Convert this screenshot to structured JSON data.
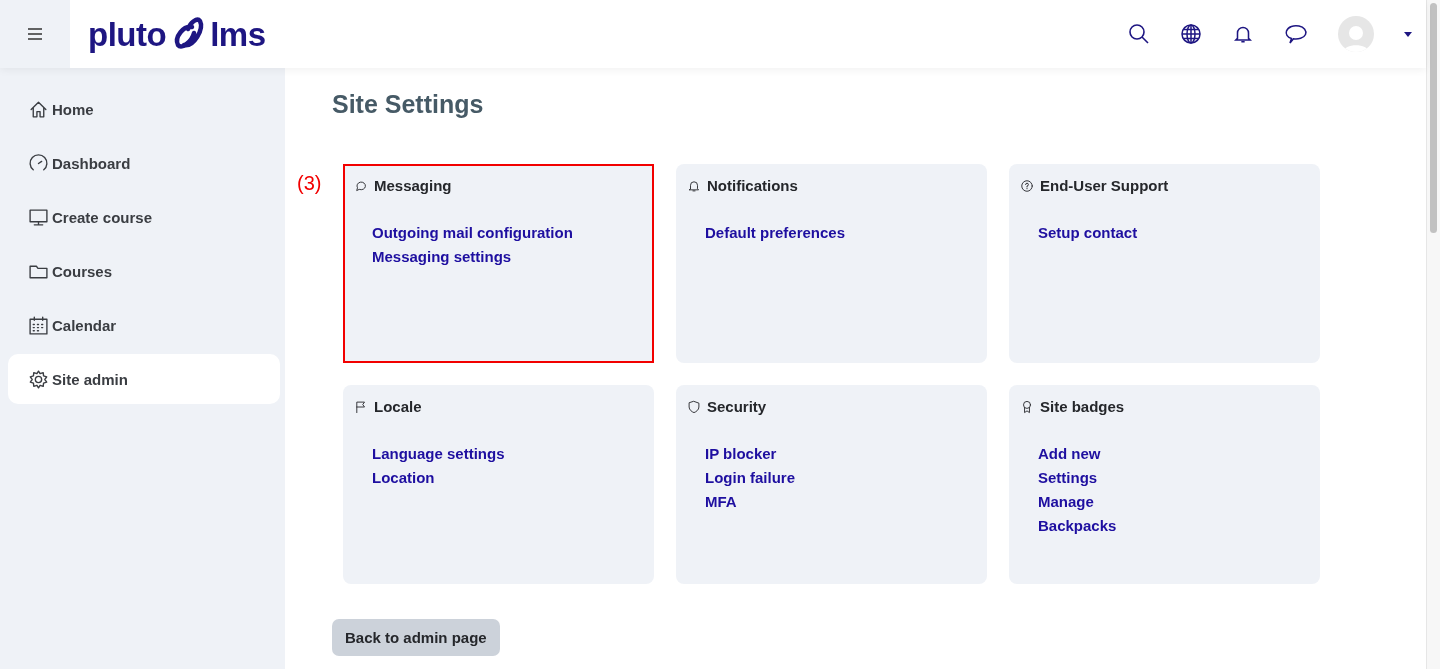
{
  "header": {
    "logo": {
      "left": "pluto",
      "right": "lms"
    }
  },
  "sidebar": {
    "items": [
      {
        "label": "Home",
        "kind": "home",
        "selected": false
      },
      {
        "label": "Dashboard",
        "kind": "gauge",
        "selected": false
      },
      {
        "label": "Create course",
        "kind": "monitor",
        "selected": false
      },
      {
        "label": "Courses",
        "kind": "folder",
        "selected": false
      },
      {
        "label": "Calendar",
        "kind": "calendar",
        "selected": false
      },
      {
        "label": "Site admin",
        "kind": "gear",
        "selected": true
      }
    ]
  },
  "page": {
    "title": "Site Settings",
    "cards": [
      {
        "title": "Messaging",
        "kind": "chat",
        "highlighted": true,
        "annotation": "(3)",
        "links": [
          "Outgoing mail configuration",
          "Messaging settings"
        ]
      },
      {
        "title": "Notifications",
        "kind": "bell",
        "highlighted": false,
        "links": [
          "Default preferences"
        ]
      },
      {
        "title": "End-User Support",
        "kind": "question",
        "highlighted": false,
        "links": [
          "Setup contact"
        ]
      },
      {
        "title": "Locale",
        "kind": "flag",
        "highlighted": false,
        "links": [
          "Language settings",
          "Location"
        ]
      },
      {
        "title": "Security",
        "kind": "shield",
        "highlighted": false,
        "links": [
          "IP blocker",
          "Login failure",
          "MFA"
        ]
      },
      {
        "title": "Site badges",
        "kind": "award",
        "highlighted": false,
        "links": [
          "Add new",
          "Settings",
          "Manage",
          "Backpacks"
        ]
      }
    ],
    "back_button": "Back to admin page"
  }
}
